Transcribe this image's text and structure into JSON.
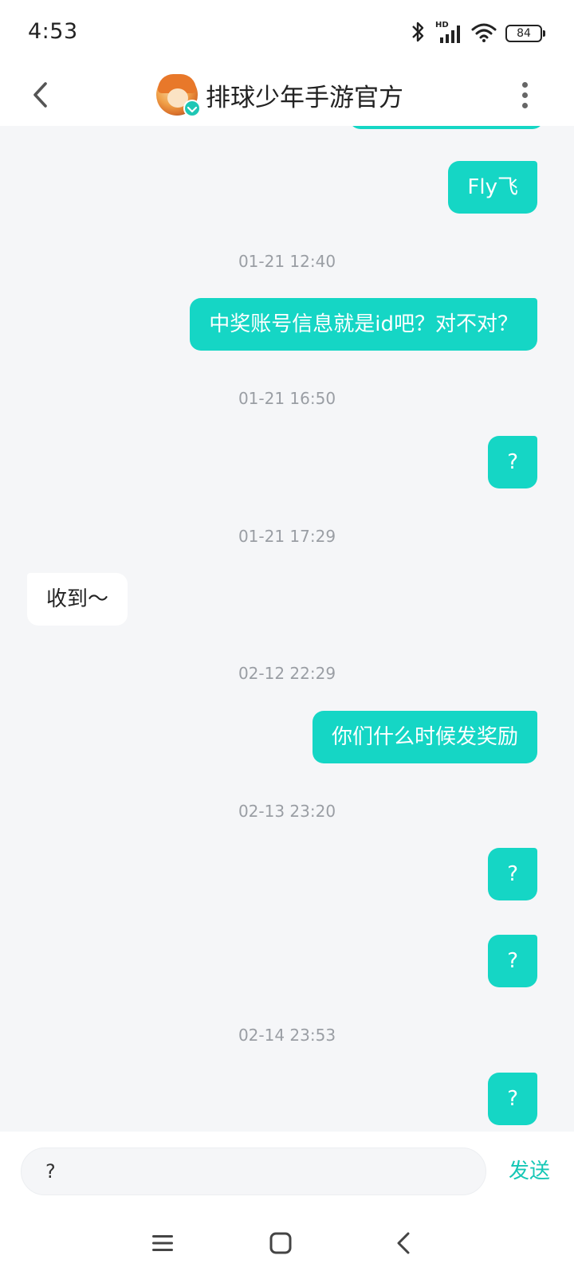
{
  "status_bar": {
    "time": "4:53",
    "network_label": "HD",
    "battery": "84"
  },
  "header": {
    "title": "排球少年手游官方"
  },
  "messages": [
    {
      "kind": "out",
      "text": "Fly飞"
    },
    {
      "kind": "time",
      "text": "01-21 12:40"
    },
    {
      "kind": "out",
      "text": "中奖账号信息就是id吧？对不对？"
    },
    {
      "kind": "time",
      "text": "01-21 16:50"
    },
    {
      "kind": "out",
      "text": "?"
    },
    {
      "kind": "time",
      "text": "01-21 17:29"
    },
    {
      "kind": "in",
      "text": "收到～"
    },
    {
      "kind": "time",
      "text": "02-12 22:29"
    },
    {
      "kind": "out",
      "text": "你们什么时候发奖励"
    },
    {
      "kind": "time",
      "text": "02-13 23:20"
    },
    {
      "kind": "out",
      "text": "?"
    },
    {
      "kind": "out",
      "text": "?"
    },
    {
      "kind": "time",
      "text": "02-14 23:53"
    },
    {
      "kind": "out",
      "text": "?"
    }
  ],
  "composer": {
    "input_value": "?",
    "send_label": "发送"
  },
  "colors": {
    "accent": "#15d6c5",
    "chat_background": "#f5f6f8"
  }
}
